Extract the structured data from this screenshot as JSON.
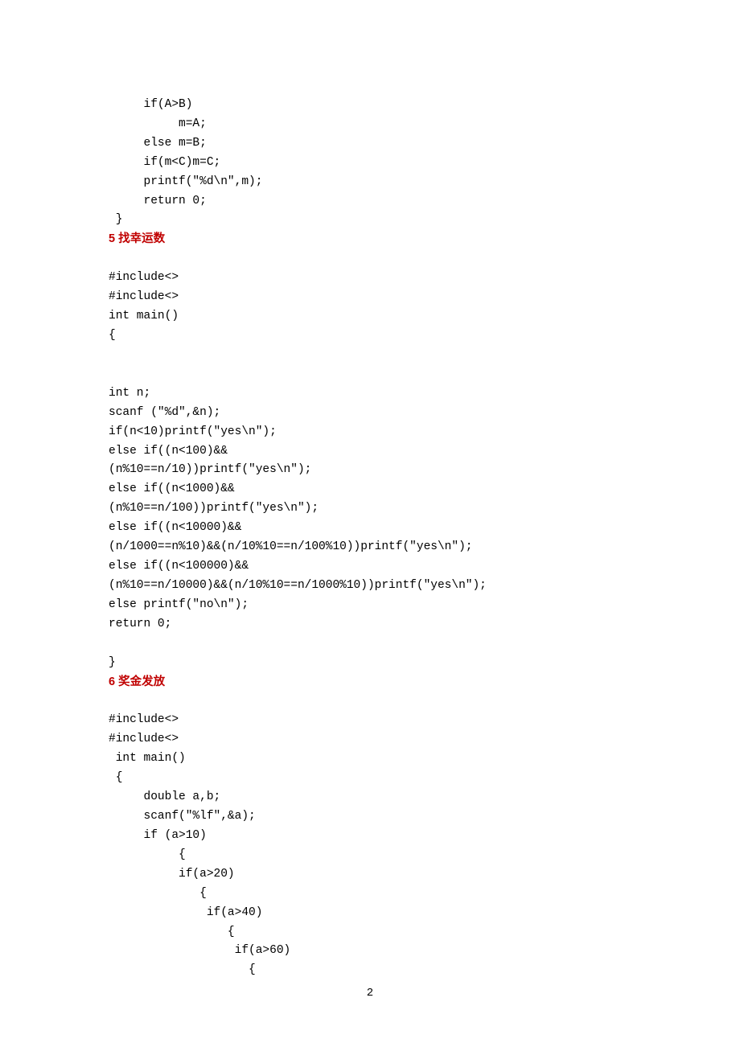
{
  "block1": {
    "l1": "     if(A>B)",
    "l2": "          m=A;",
    "l3": "     else m=B;",
    "l4": "     if(m<C)m=C;",
    "l5": "     printf(\"%d\\n\",m);",
    "l6": "     return 0;",
    "l7": " }"
  },
  "heading5": "5 找幸运数",
  "block2": {
    "l1": "#include<>",
    "l2": "#include<>",
    "l3": "int main()",
    "l4": "{",
    "l5": "int n;",
    "l6": "scanf (\"%d\",&n);",
    "l7": "if(n<10)printf(\"yes\\n\");",
    "l8": "else if((n<100)&&",
    "l9": "(n%10==n/10))printf(\"yes\\n\");",
    "l10": "else if((n<1000)&&",
    "l11": "(n%10==n/100))printf(\"yes\\n\");",
    "l12": "else if((n<10000)&&",
    "l13": "(n/1000==n%10)&&(n/10%10==n/100%10))printf(\"yes\\n\");",
    "l14": "else if((n<100000)&&",
    "l15": "(n%10==n/10000)&&(n/10%10==n/1000%10))printf(\"yes\\n\");",
    "l16": "else printf(\"no\\n\");",
    "l17": "return 0;",
    "l18": "}"
  },
  "heading6": "6 奖金发放",
  "block3": {
    "l1": "#include<>",
    "l2": "#include<>",
    "l3": " int main()",
    "l4": " {",
    "l5": "     double a,b;",
    "l6": "     scanf(\"%lf\",&a);",
    "l7": "     if (a>10)",
    "l8": "          {",
    "l9": "          if(a>20)",
    "l10": "             {",
    "l11": "              if(a>40)",
    "l12": "                 {",
    "l13": "                  if(a>60)",
    "l14": "                    {"
  },
  "pageNumber": "2"
}
